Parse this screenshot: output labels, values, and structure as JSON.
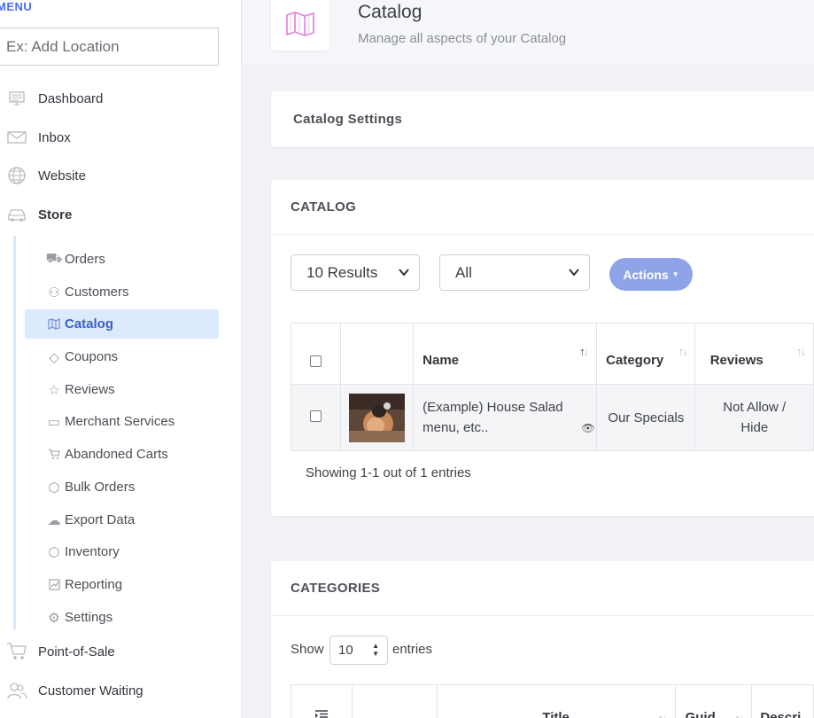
{
  "sidebar": {
    "menu_label": "MENU",
    "location_placeholder": "Ex: Add Location",
    "items": [
      {
        "label": "Dashboard",
        "icon": "monitor-icon"
      },
      {
        "label": "Inbox",
        "icon": "envelope-icon"
      },
      {
        "label": "Website",
        "icon": "globe-icon"
      },
      {
        "label": "Store",
        "icon": "car-icon"
      },
      {
        "label": "Point-of-Sale",
        "icon": "cart-icon"
      },
      {
        "label": "Customer Waiting",
        "icon": "users-icon"
      }
    ],
    "store_sub": [
      {
        "label": "Orders",
        "icon": "car-small-icon"
      },
      {
        "label": "Customers",
        "icon": "users-small-icon"
      },
      {
        "label": "Catalog",
        "icon": "map-icon"
      },
      {
        "label": "Coupons",
        "icon": "tag-icon"
      },
      {
        "label": "Reviews",
        "icon": "star-icon"
      },
      {
        "label": "Merchant Services",
        "icon": "card-icon"
      },
      {
        "label": "Abandoned Carts",
        "icon": "cart-small-icon"
      },
      {
        "label": "Bulk Orders",
        "icon": "box-icon"
      },
      {
        "label": "Export Data",
        "icon": "cloud-upload-icon"
      },
      {
        "label": "Inventory",
        "icon": "box2-icon"
      },
      {
        "label": "Reporting",
        "icon": "chart-icon"
      },
      {
        "label": "Settings",
        "icon": "gear-icon"
      }
    ],
    "active_sub": "Catalog"
  },
  "header": {
    "title": "Catalog",
    "subtitle": "Manage all aspects of your Catalog",
    "icon": "map-icon"
  },
  "settings_card": {
    "title": "Catalog Settings"
  },
  "catalog_card": {
    "title": "CATALOG",
    "results_select": "10 Results",
    "filter_select": "All",
    "actions_label": "Actions",
    "columns": [
      "Name",
      "Category",
      "Reviews"
    ],
    "rows": [
      {
        "name": "(Example) House Salad menu, etc..",
        "category": "Our Specials",
        "reviews_line1": "Not Allow /",
        "reviews_line2": "Hide"
      }
    ],
    "showing": "Showing 1-1 out of 1 entries"
  },
  "categories_card": {
    "title": "CATEGORIES",
    "show_label": "Show",
    "show_value": "10",
    "entries_label": "entries",
    "columns": [
      "Title",
      "Guid",
      "Descri"
    ]
  },
  "colors": {
    "accent": "#4a6cf7",
    "active_bg": "#dcebfb",
    "actions_btn": "#8ea3e8"
  }
}
